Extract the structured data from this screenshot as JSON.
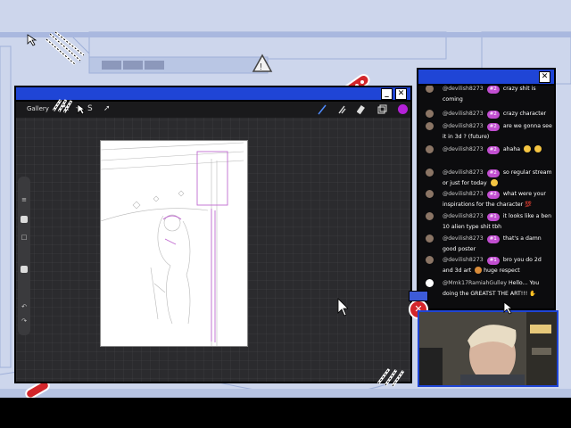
{
  "procreate": {
    "gallery_label": "Gallery",
    "minimize_label": "_",
    "close_label": "✕"
  },
  "chat": {
    "close_label": "✕",
    "messages": [
      {
        "user": "",
        "badge": "",
        "text": "crazy shit is coming",
        "prefix": "@devilish8273",
        "b": "#2"
      },
      {
        "user": "@devilish8273",
        "badge": "#2",
        "text": "crazy character"
      },
      {
        "user": "@devilish8273",
        "badge": "#2",
        "text": "are we gonna see it in 3d ? (future)"
      },
      {
        "user": "@devilish8273",
        "badge": "#2",
        "text": "ahaha"
      },
      {
        "user": "@devilish8273",
        "badge": "#2",
        "text": "so regular stream or just for today"
      },
      {
        "user": "@devilish8273",
        "badge": "#2",
        "text": "what were your inspirations for the character"
      },
      {
        "user": "@devilish8273",
        "badge": "#1",
        "text": "it looks like a ben 10 alien type shit tbh"
      },
      {
        "user": "@devilish8273",
        "badge": "#1",
        "text": "that's a damn good poster"
      },
      {
        "user": "@devilish8273",
        "badge": "#1",
        "text": "bro you do 2d and 3d art"
      },
      {
        "user": "@Mmk17RamiahGulley",
        "badge": "",
        "text": "Hello... You doing the GREATST THE ART!!!"
      }
    ],
    "extra": {
      "m4_tail": "huge respect",
      "m6_emoji": "💯"
    }
  },
  "colors": {
    "titlebar": "#1f45d6",
    "badge": "#c14ed0",
    "accent_red": "#d3262b",
    "active_color": "#b521d8"
  }
}
